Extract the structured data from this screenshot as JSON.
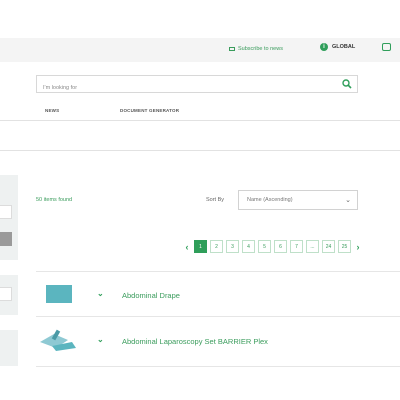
{
  "header": {
    "subscribe_label": "Subscribe to news",
    "country_label": "GLOBAL"
  },
  "search": {
    "placeholder": "I'm looking for"
  },
  "nav": {
    "items": [
      {
        "label": "NEWS"
      },
      {
        "label": "DOCUMENT GENERATOR"
      }
    ]
  },
  "results": {
    "count_label": "50 items found",
    "sort_label": "Sort By",
    "sort_value": "Name (Ascending)"
  },
  "pagination": {
    "prev": "‹",
    "next": "›",
    "pages": [
      "1",
      "2",
      "3",
      "4",
      "5",
      "6",
      "7",
      "...",
      "24",
      "25"
    ],
    "active_page": "1"
  },
  "products": [
    {
      "name": "Abdominal Drape"
    },
    {
      "name": "Abdominal Laparoscopy Set BARRIER Plex"
    }
  ],
  "colors": {
    "accent": "#2f9e5a",
    "thumb": "#5bb5bf"
  }
}
